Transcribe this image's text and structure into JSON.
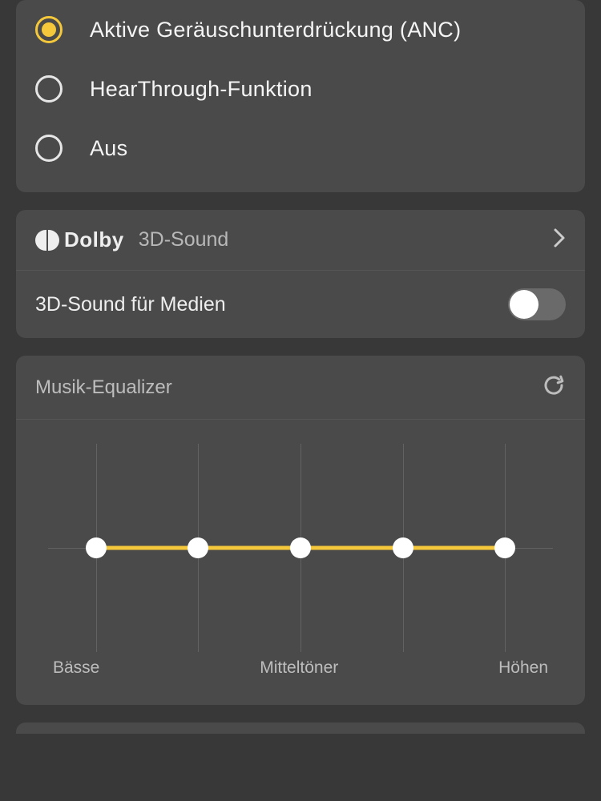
{
  "anc": {
    "options": [
      {
        "label": "Aktive Geräuschunterdrückung (ANC)",
        "selected": true
      },
      {
        "label": "HearThrough-Funktion",
        "selected": false
      },
      {
        "label": "Aus",
        "selected": false
      }
    ]
  },
  "dolby": {
    "brand": "Dolby",
    "link_label": "3D-Sound",
    "toggle_label": "3D-Sound für Medien",
    "toggle_on": false
  },
  "equalizer": {
    "title": "Musik-Equalizer",
    "labels": {
      "low": "Bässe",
      "mid": "Mitteltöner",
      "high": "Höhen"
    },
    "bands": [
      0,
      0,
      0,
      0,
      0
    ]
  },
  "colors": {
    "accent": "#f4c83a"
  }
}
